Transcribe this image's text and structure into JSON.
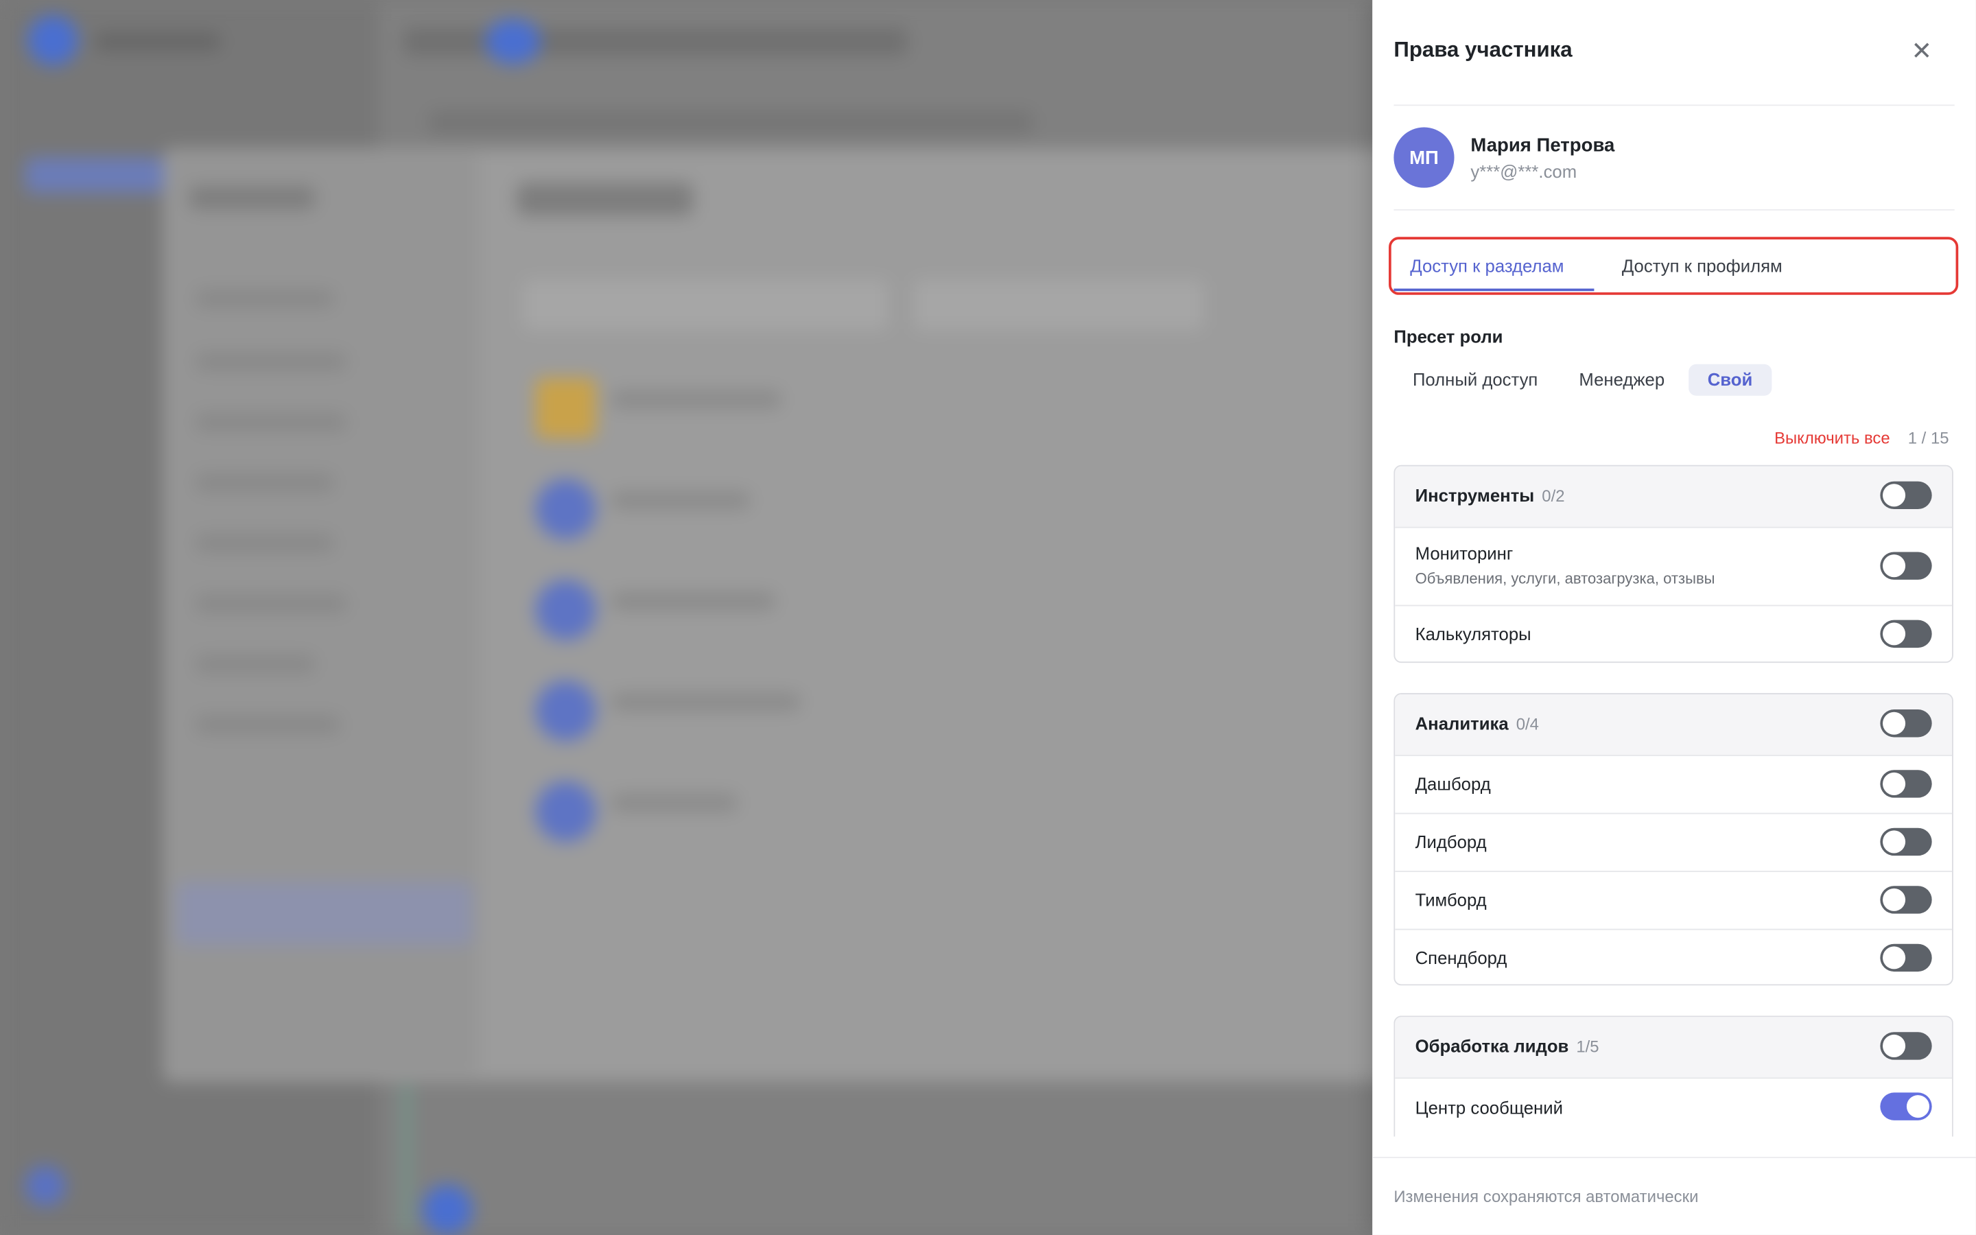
{
  "drawer": {
    "title": "Права участника",
    "close_icon": "close-icon",
    "user": {
      "initials": "МП",
      "name": "Мария Петрова",
      "email": "y***@***.com",
      "avatar_color": "#6a74d8"
    },
    "tabs": [
      {
        "label": "Доступ к разделам",
        "active": true
      },
      {
        "label": "Доступ к профилям",
        "active": false
      }
    ],
    "preset": {
      "title": "Пресет роли",
      "options": [
        {
          "label": "Полный доступ",
          "selected": false
        },
        {
          "label": "Менеджер",
          "selected": false
        },
        {
          "label": "Свой",
          "selected": true
        }
      ]
    },
    "disable_all": "Выключить все",
    "counter": "1 / 15",
    "groups": [
      {
        "title": "Инструменты",
        "count": "0/2",
        "enabled": false,
        "items": [
          {
            "label": "Мониторинг",
            "sub": "Объявления, услуги, автозагрузка, отзывы",
            "enabled": false
          },
          {
            "label": "Калькуляторы",
            "enabled": false
          }
        ]
      },
      {
        "title": "Аналитика",
        "count": "0/4",
        "enabled": false,
        "items": [
          {
            "label": "Дашборд",
            "enabled": false
          },
          {
            "label": "Лидборд",
            "enabled": false
          },
          {
            "label": "Тимборд",
            "enabled": false
          },
          {
            "label": "Спендборд",
            "enabled": false
          }
        ]
      },
      {
        "title": "Обработка лидов",
        "count": "1/5",
        "enabled": false,
        "items": [
          {
            "label": "Центр сообщений",
            "enabled": true
          }
        ]
      }
    ],
    "footer": "Изменения сохраняются автоматически",
    "accent_color": "#5563cf",
    "danger_color": "#e53935"
  }
}
